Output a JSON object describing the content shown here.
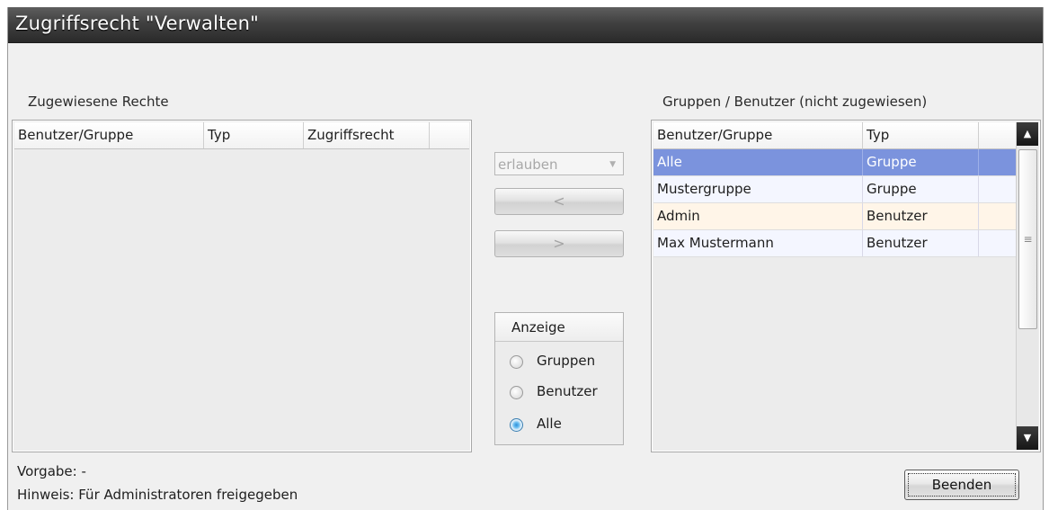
{
  "window": {
    "title": "Zugriffsrecht \"Verwalten\""
  },
  "assigned": {
    "label": "Zugewiesene Rechte",
    "columns": [
      "Benutzer/Gruppe",
      "Typ",
      "Zugriffsrecht"
    ],
    "rows": []
  },
  "center": {
    "permission_combo": {
      "value": "erlauben",
      "arrow_icon": "dropdown-arrow-icon"
    },
    "add_button_label": "<",
    "remove_button_label": ">",
    "display_group": {
      "title": "Anzeige",
      "options": [
        {
          "label": "Gruppen",
          "checked": false
        },
        {
          "label": "Benutzer",
          "checked": false
        },
        {
          "label": "Alle",
          "checked": true
        }
      ]
    }
  },
  "unassigned": {
    "label": "Gruppen / Benutzer (nicht zugewiesen)",
    "columns": [
      "Benutzer/Gruppe",
      "Typ"
    ],
    "rows": [
      {
        "name": "Alle",
        "type": "Gruppe",
        "selected": true
      },
      {
        "name": "Mustergruppe",
        "type": "Gruppe",
        "selected": false
      },
      {
        "name": "Admin",
        "type": "Benutzer",
        "selected": false
      },
      {
        "name": "Max Mustermann",
        "type": "Benutzer",
        "selected": false
      }
    ],
    "scrollbar": {
      "up_icon": "scroll-up-icon",
      "down_icon": "scroll-down-icon",
      "grip_icon": "grip-icon"
    }
  },
  "footer": {
    "default_text": "Vorgabe: -",
    "hint_text": "Hinweis: Für Administratoren freigegeben",
    "close_button_label": "Beenden"
  },
  "colors": {
    "titlebar": "#404040",
    "selection": "#7b93dd",
    "radio_checked": "#2f8fd8"
  }
}
